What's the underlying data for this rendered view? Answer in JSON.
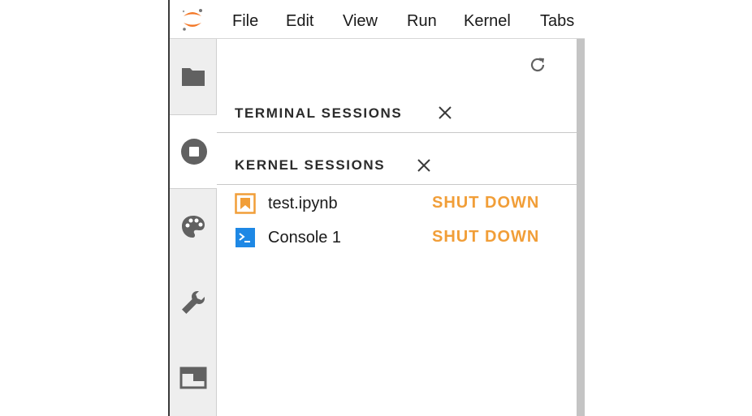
{
  "menubar": {
    "items": [
      {
        "label": "File"
      },
      {
        "label": "Edit"
      },
      {
        "label": "View"
      },
      {
        "label": "Run"
      },
      {
        "label": "Kernel"
      },
      {
        "label": "Tabs"
      }
    ]
  },
  "sidebar": {
    "tabs": [
      {
        "icon": "folder-icon"
      },
      {
        "icon": "stop-circle-icon",
        "active": true
      },
      {
        "icon": "palette-icon"
      },
      {
        "icon": "wrench-icon"
      },
      {
        "icon": "tabs-icon"
      }
    ]
  },
  "running_panel": {
    "refresh_icon": "refresh-icon",
    "terminal_sessions": {
      "title": "TERMINAL SESSIONS",
      "items": []
    },
    "kernel_sessions": {
      "title": "KERNEL SESSIONS",
      "items": [
        {
          "name": "test.ipynb",
          "icon": "notebook-icon",
          "action": "SHUT DOWN"
        },
        {
          "name": "Console 1",
          "icon": "console-icon",
          "action": "SHUT DOWN"
        }
      ]
    }
  },
  "colors": {
    "accent_orange": "#f19e38",
    "console_blue": "#1e88e5",
    "icon_gray": "#616161"
  }
}
